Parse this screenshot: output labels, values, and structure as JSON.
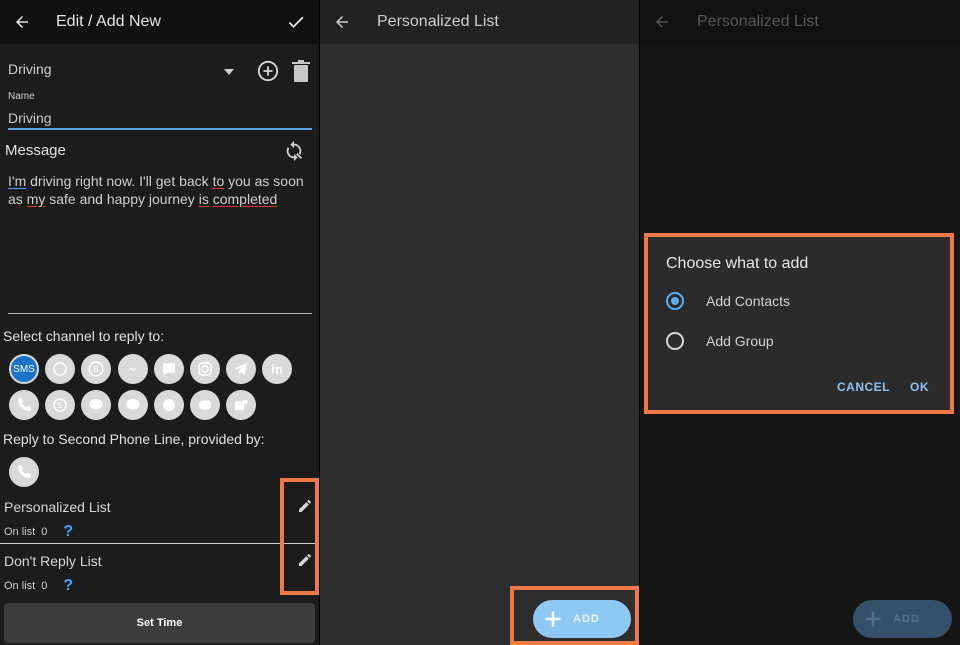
{
  "panel1": {
    "title": "Edit / Add New",
    "profile_value": "Driving",
    "name_label": "Name",
    "name_value": "Driving",
    "message_label": "Message",
    "message_parts": [
      "I'm",
      " driving right now. I'll get back ",
      "to",
      " you as soon as ",
      "my",
      " safe and happy journey ",
      "is",
      " ",
      "completed"
    ],
    "channels_label": "Select channel to reply to:",
    "sms_label": "SMS",
    "second_line_label": "Reply to Second Phone Line, provided by:",
    "personalized_list": {
      "label": "Personalized List",
      "on_list_label": "On list",
      "count": "0",
      "help": "?"
    },
    "dont_reply_list": {
      "label": "Don't Reply List",
      "on_list_label": "On list",
      "count": "0",
      "help": "?"
    },
    "set_time_label": "Set Time"
  },
  "panel2": {
    "title": "Personalized List",
    "add_label": "ADD"
  },
  "panel3": {
    "title": "Personalized List",
    "dialog": {
      "title": "Choose what to add",
      "options": [
        "Add Contacts",
        "Add Group"
      ],
      "selected": "Add Contacts",
      "cancel_label": "CANCEL",
      "ok_label": "OK"
    },
    "add_label": "ADD"
  },
  "colors": {
    "highlight": "#f07a45",
    "accent_blue": "#5ab0f2",
    "sms_blue": "#1a73c8"
  },
  "icons": [
    "back-arrow-icon",
    "check-icon",
    "dropdown-arrow-icon",
    "add-circle-icon",
    "trash-icon",
    "sync-icon",
    "pencil-icon",
    "plus-icon",
    "phone-icon"
  ]
}
